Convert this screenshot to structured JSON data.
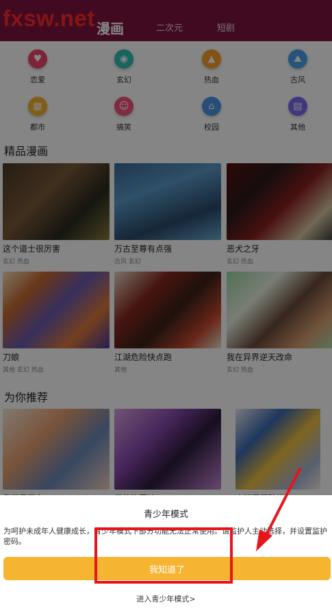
{
  "watermark": "fxsw.net",
  "tabs": [
    {
      "label": "漫画",
      "active": true
    },
    {
      "label": "二次元",
      "active": false
    },
    {
      "label": "短剧",
      "active": false
    }
  ],
  "categories": [
    {
      "label": "恋爱",
      "icon": "heart-icon",
      "color": "#f0476a"
    },
    {
      "label": "玄幻",
      "icon": "swirl-icon",
      "color": "#2fc0b5"
    },
    {
      "label": "热血",
      "icon": "flame-icon",
      "color": "#f8a22a"
    },
    {
      "label": "古风",
      "icon": "mountain-icon",
      "color": "#4aa2ee"
    },
    {
      "label": "都市",
      "icon": "building-icon",
      "color": "#f8b32e"
    },
    {
      "label": "搞笑",
      "icon": "smile-icon",
      "color": "#f5537a"
    },
    {
      "label": "校园",
      "icon": "school-icon",
      "color": "#4d95e8"
    },
    {
      "label": "其他",
      "icon": "grid-icon",
      "color": "#7a6cf0"
    }
  ],
  "featured": {
    "title": "精品漫画",
    "items": [
      {
        "title": "这个道士很厉害",
        "tags": "玄幻 热血"
      },
      {
        "title": "万古至尊有点强",
        "tags": "古风 玄幻"
      },
      {
        "title": "恶犬之牙",
        "tags": "玄幻 热血"
      },
      {
        "title": "刀娘",
        "tags": "其他 玄幻 热血"
      },
      {
        "title": "江湖危险快点跑",
        "tags": "其他"
      },
      {
        "title": "我在异界逆天改命",
        "tags": "玄幻 热血"
      }
    ]
  },
  "recommend": {
    "title": "为你推荐",
    "items": [
      {
        "title": "我不是恶女"
      },
      {
        "title": "天使许愿馆"
      },
      {
        "title": "小猪零压险记"
      }
    ]
  },
  "sheet": {
    "title": "青少年模式",
    "description": "为呵护未成年人健康成长，青少年模式下部分功能无法正常使用。请监护人主动选择，并设置监护密码。",
    "ok_label": "我知道了",
    "enter_label": "进入青少年模式>"
  },
  "colors": {
    "header": "#7e1440",
    "watermark": "#ff2a2a",
    "button": "#f6b531",
    "annotation": "#e8141b"
  }
}
